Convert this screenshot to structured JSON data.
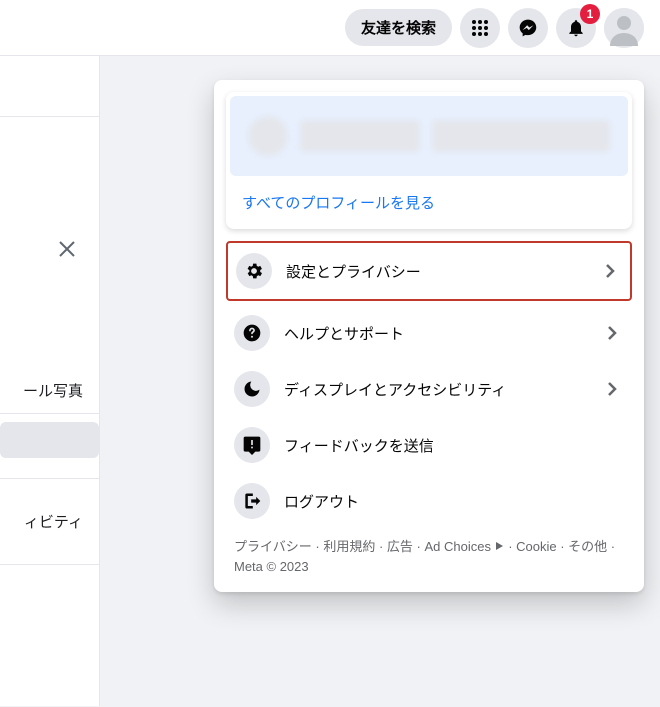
{
  "header": {
    "search_label": "友達を検索",
    "notification_count": "1"
  },
  "left_panel": {
    "item1": "ール写真",
    "item2": "ィビティ"
  },
  "dropdown": {
    "view_all_profiles": "すべてのプロフィールを見る",
    "menu": [
      {
        "label": "設定とプライバシー",
        "has_chevron": true,
        "highlighted": true
      },
      {
        "label": "ヘルプとサポート",
        "has_chevron": true,
        "highlighted": false
      },
      {
        "label": "ディスプレイとアクセシビリティ",
        "has_chevron": true,
        "highlighted": false
      },
      {
        "label": "フィードバックを送信",
        "has_chevron": false,
        "highlighted": false
      },
      {
        "label": "ログアウト",
        "has_chevron": false,
        "highlighted": false
      }
    ],
    "footer": {
      "privacy": "プライバシー",
      "terms": "利用規約",
      "ads": "広告",
      "ad_choices": "Ad Choices",
      "cookie": "Cookie",
      "more": "その他",
      "copyright": "Meta © 2023"
    }
  }
}
